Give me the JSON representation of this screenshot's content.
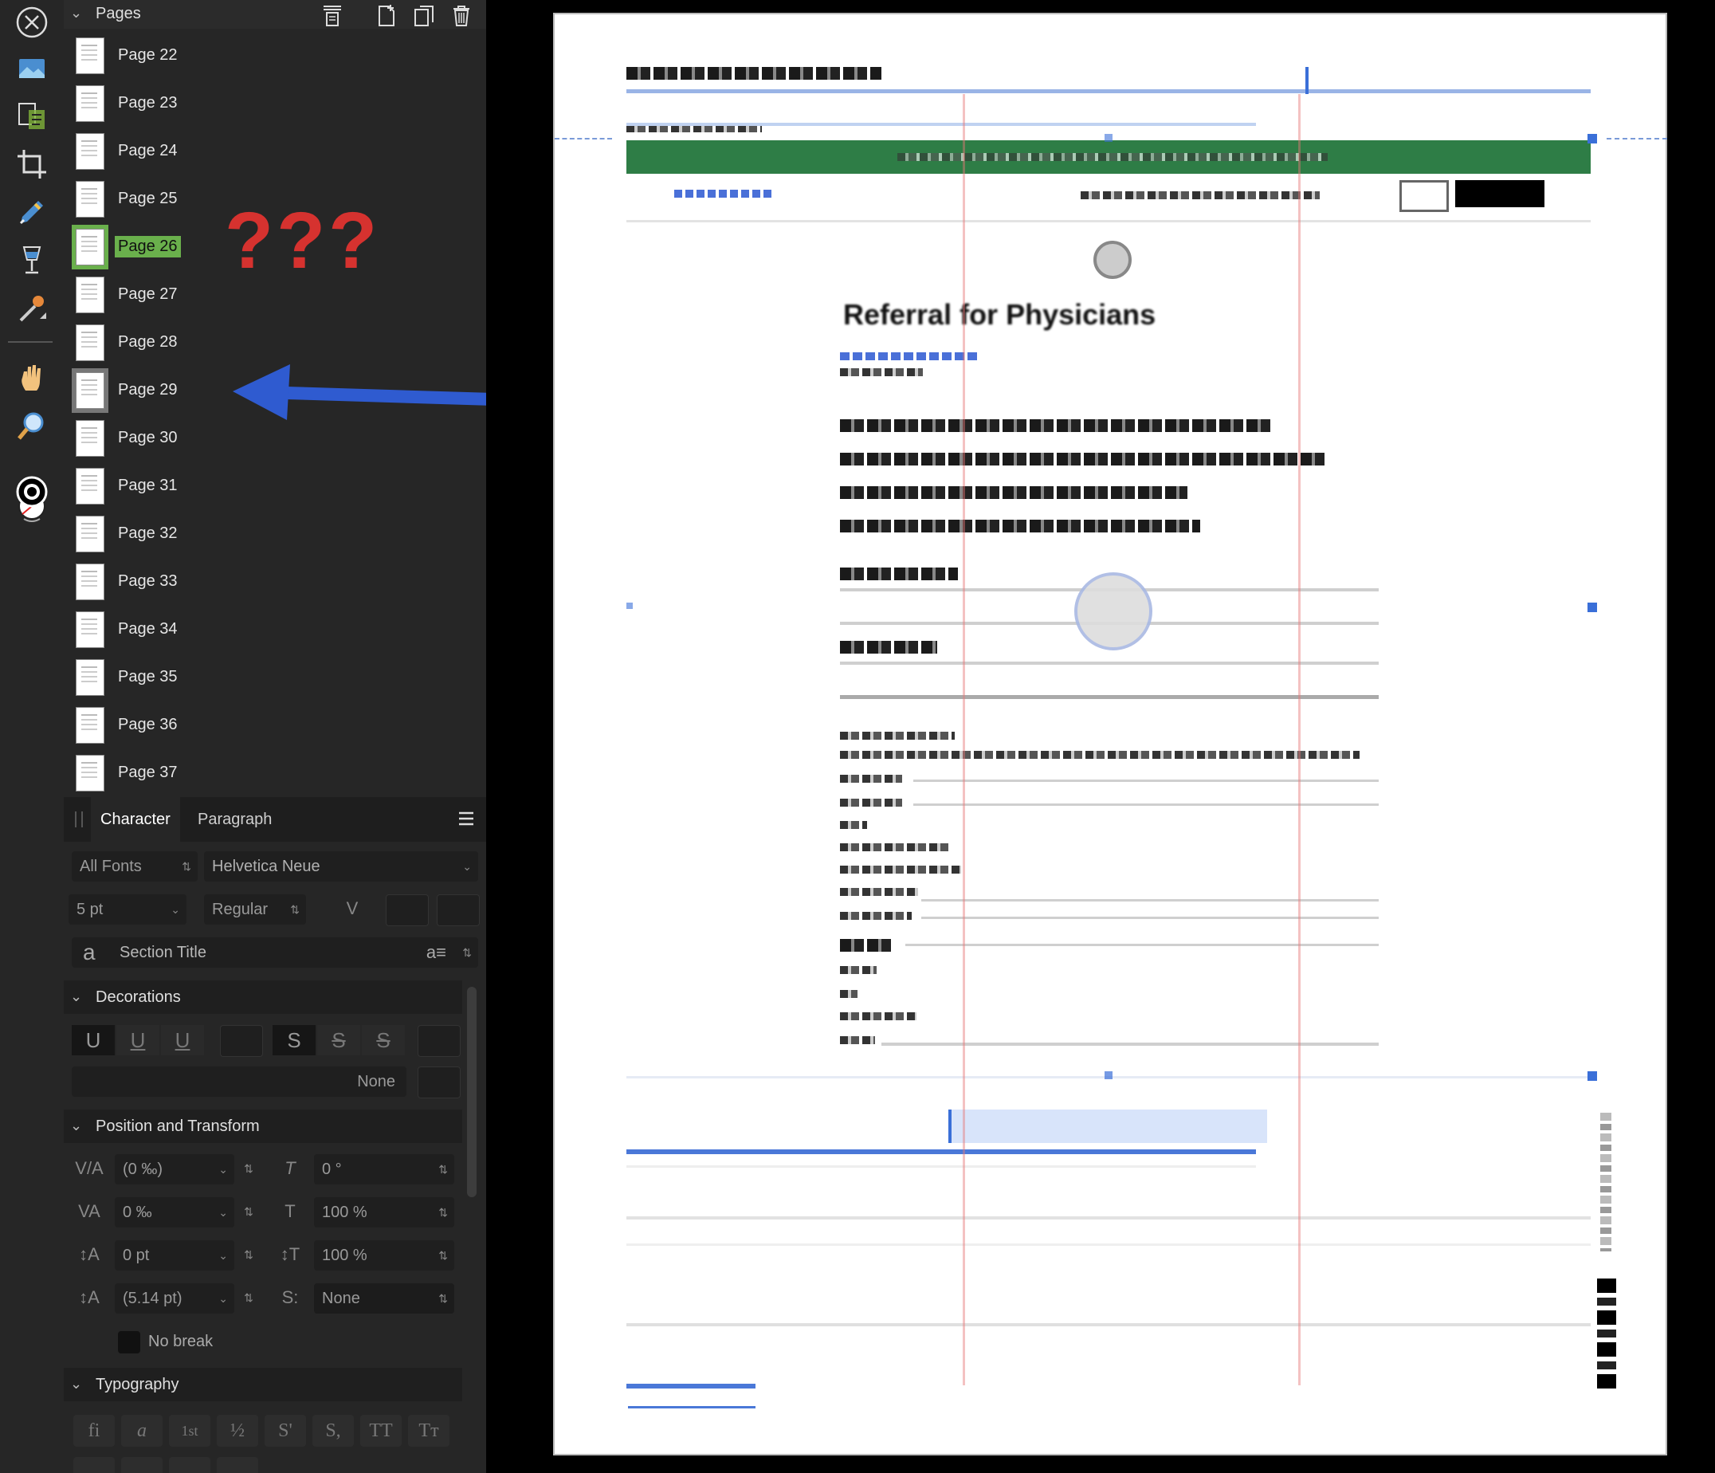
{
  "pages_panel": {
    "title": "Pages",
    "pages": [
      "Page 22",
      "Page 23",
      "Page 24",
      "Page 25",
      "Page 26",
      "Page 27",
      "Page 28",
      "Page 29",
      "Page 30",
      "Page 31",
      "Page 32",
      "Page 33",
      "Page 34",
      "Page 35",
      "Page 36",
      "Page 37"
    ],
    "selected": "Page 26",
    "highlighted": "Page 29"
  },
  "annotation": {
    "text": "???",
    "color": "#d6322f",
    "arrow_color": "#2f5bd0"
  },
  "character_panel": {
    "tabs": [
      "Character",
      "Paragraph"
    ],
    "font_collection": "All Fonts",
    "font_family": "Helvetica Neue",
    "font_size": "5 pt",
    "font_style": "Regular",
    "style_name": "Section Title",
    "decorations": {
      "title": "Decorations",
      "buttons": [
        "U",
        "U",
        "U",
        "S",
        "S",
        "S"
      ],
      "value": "None"
    },
    "position_transform": {
      "title": "Position and Transform",
      "kerning": "(0 ‰)",
      "skew": "0 °",
      "tracking": "0 ‰",
      "vertical_scale": "100 %",
      "baseline": "0 pt",
      "horizontal_scale": "100 %",
      "leading": "(5.14 pt)",
      "superscript": "None",
      "no_break": "No break"
    },
    "typography": {
      "title": "Typography",
      "buttons": [
        "fi",
        "a",
        "1st",
        "½",
        "S'",
        "S,",
        "TT",
        "Tт"
      ]
    }
  },
  "document": {
    "heading": "Referral for Physicians",
    "colors": {
      "green_banner": "#2e7d46",
      "selection_blue": "#3a6fd8",
      "guide_red": "#e88"
    }
  },
  "colors": {
    "panel_bg": "#262626",
    "accent_green": "#6ab04c"
  }
}
